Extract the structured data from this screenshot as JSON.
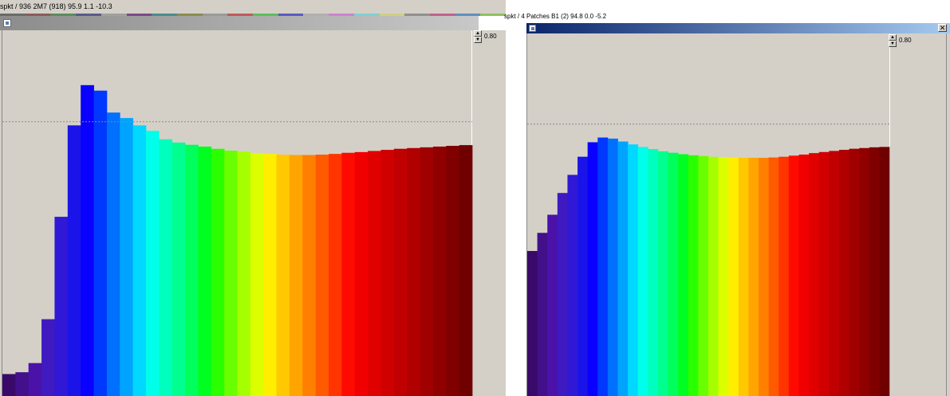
{
  "left_window": {
    "info_text": "spkt / 936        2M7  (918)  95.9   1.1 -10.3",
    "spinner_value": "0.80",
    "bar_values": [
      0.06,
      0.065,
      0.09,
      0.21,
      0.49,
      0.74,
      0.85,
      0.835,
      0.775,
      0.76,
      0.74,
      0.725,
      0.702,
      0.693,
      0.687,
      0.682,
      0.676,
      0.671,
      0.668,
      0.664,
      0.662,
      0.66,
      0.659,
      0.659,
      0.66,
      0.662,
      0.665,
      0.667,
      0.67,
      0.673,
      0.676,
      0.678,
      0.68,
      0.682,
      0.684,
      0.686
    ],
    "reference_level": 0.75
  },
  "right_window": {
    "info_text": "spkt / 4 Patches   B1   (2)  94.8   0.0  -5.2",
    "spinner_value": "0.80",
    "close_glyph": "✕",
    "bar_values": [
      0.4,
      0.45,
      0.5,
      0.56,
      0.61,
      0.66,
      0.7,
      0.713,
      0.71,
      0.702,
      0.694,
      0.687,
      0.681,
      0.675,
      0.671,
      0.667,
      0.664,
      0.662,
      0.66,
      0.659,
      0.658,
      0.657,
      0.657,
      0.657,
      0.658,
      0.66,
      0.663,
      0.666,
      0.67,
      0.673,
      0.676,
      0.679,
      0.682,
      0.684,
      0.686,
      0.687
    ],
    "reference_level": 0.75
  },
  "spectrum_colors": [
    "#3a0a6a",
    "#42108a",
    "#4a12a8",
    "#3e1ac0",
    "#3018d6",
    "#1a14e8",
    "#0a00ff",
    "#0038ff",
    "#0070ff",
    "#00a4ff",
    "#00d8ff",
    "#00ffea",
    "#00ffbe",
    "#00ff8e",
    "#00ff5a",
    "#00ff20",
    "#2aff00",
    "#6aff00",
    "#a6ff00",
    "#dcff00",
    "#ffee00",
    "#ffc800",
    "#ffa400",
    "#ff8000",
    "#ff5a00",
    "#ff3400",
    "#ff0a00",
    "#f00000",
    "#e00000",
    "#d00000",
    "#c00000",
    "#b00000",
    "#a00000",
    "#900000",
    "#800000",
    "#700000"
  ],
  "top_strip_colors": [
    "#6a6a6a",
    "#8c5a5a",
    "#5a8c5a",
    "#5a5a8c",
    "#a0a0a0",
    "#7a4a8c",
    "#4a8c8c",
    "#8c8c4a",
    "#9a9a9a",
    "#c05a5a",
    "#5ac05a",
    "#5a5ac0",
    "#b0b0b0",
    "#d080d0",
    "#80d0d0",
    "#d0d080",
    "#909090",
    "#c06090",
    "#6090c0",
    "#90c060"
  ]
}
